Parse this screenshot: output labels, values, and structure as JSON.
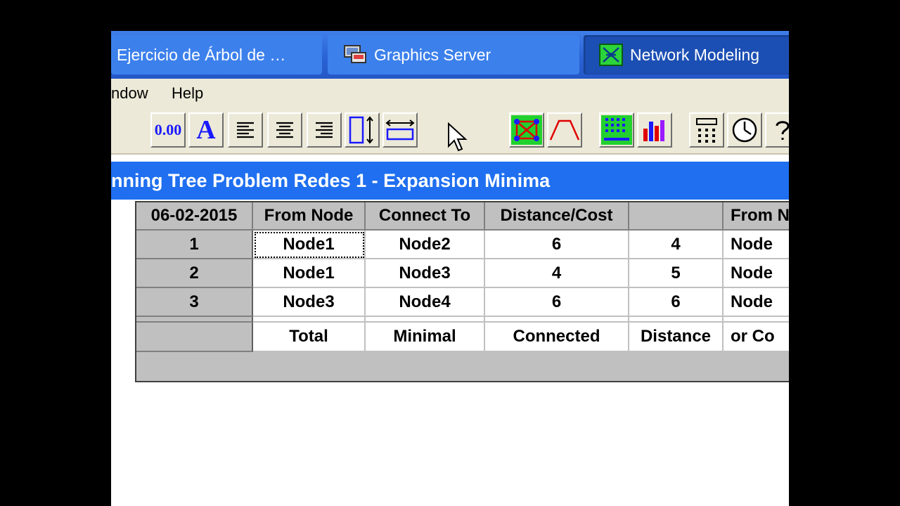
{
  "taskbar": {
    "tasks": [
      {
        "label": "Ejercicio de Árbol de …",
        "icon": "document-icon"
      },
      {
        "label": "Graphics Server",
        "icon": "graphics-server-icon"
      },
      {
        "label": "Network Modeling",
        "icon": "network-modeling-icon",
        "active": true
      }
    ]
  },
  "menu": {
    "items": [
      "ndow",
      "Help"
    ]
  },
  "toolbar": {
    "number_format_label": "0.00",
    "font_label": "A"
  },
  "window": {
    "title": "nning Tree Problem Redes 1 - Expansion Minima"
  },
  "grid": {
    "corner": "06-02-2015",
    "headers": [
      "From Node",
      "Connect To",
      "Distance/Cost",
      "",
      "From N"
    ],
    "rows": [
      {
        "label": "1",
        "cells": [
          "Node1",
          "Node2",
          "6",
          "4",
          "Node"
        ]
      },
      {
        "label": "2",
        "cells": [
          "Node1",
          "Node3",
          "4",
          "5",
          "Node"
        ]
      },
      {
        "label": "3",
        "cells": [
          "Node3",
          "Node4",
          "6",
          "6",
          "Node"
        ]
      }
    ],
    "total_row": [
      "Total",
      "Minimal",
      "Connected",
      "Distance",
      "or Co"
    ]
  },
  "colors": {
    "taskbar": "#2a63d6",
    "title_bar": "#1f6ff0",
    "menu_bg": "#ece9d8",
    "grid_header": "#c0c0c0"
  }
}
